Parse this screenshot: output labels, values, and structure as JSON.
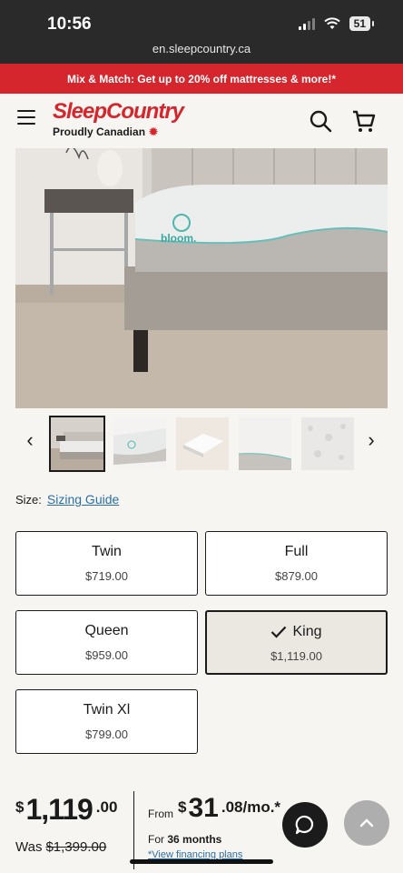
{
  "status": {
    "time": "10:56",
    "battery": "51"
  },
  "browser": {
    "url": "en.sleepcountry.ca"
  },
  "promo": {
    "text": "Mix & Match: Get up to 20% off mattresses & more!*"
  },
  "header": {
    "logo_main": "SleepCountry",
    "logo_sub": "Proudly Canadian"
  },
  "product": {
    "hero_brand": "bloom.",
    "thumbnails": [
      "bed-front",
      "mattress-side",
      "mattress-box",
      "mattress-corner",
      "fabric-closeup"
    ],
    "selected_thumbnail": 0
  },
  "size": {
    "label": "Size:",
    "guide_link": "Sizing Guide",
    "options": [
      {
        "name": "Twin",
        "price": "$719.00"
      },
      {
        "name": "Full",
        "price": "$879.00"
      },
      {
        "name": "Queen",
        "price": "$959.00"
      },
      {
        "name": "King",
        "price": "$1,119.00"
      },
      {
        "name": "Twin Xl",
        "price": "$799.00"
      }
    ],
    "selected": "King"
  },
  "price": {
    "currency": "$",
    "dollars": "1,119",
    "cents": ".00",
    "was_label": "Was",
    "was_value": "$1,399.00"
  },
  "financing": {
    "from_label": "From",
    "currency": "$",
    "dollars": "31",
    "cents": ".08/mo.*",
    "for_prefix": "For",
    "months": "36 months",
    "link": "*View financing plans"
  },
  "colors": {
    "accent": "#d5262d",
    "link": "#2c6fa6",
    "background": "#f7f5f1"
  }
}
